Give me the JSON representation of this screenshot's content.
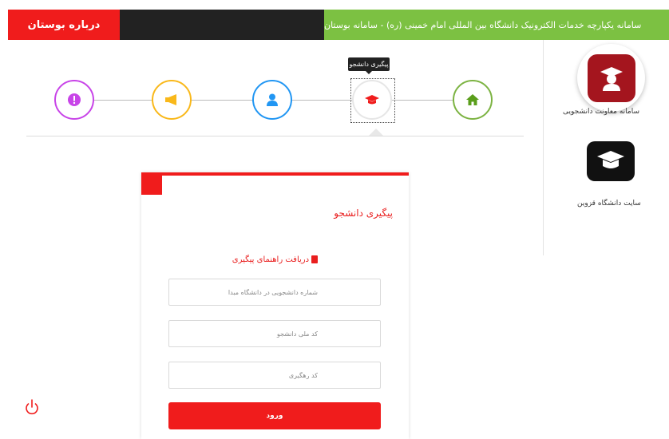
{
  "topbar": {
    "about_label": "درباره بوستان",
    "system_title": "سامانه یکپارچه خدمات الکترونیک دانشگاه بین المللی امام خمینی (ره) - سامانه بوستان"
  },
  "steps": {
    "active_tooltip": "پیگیری دانشجو",
    "items": [
      "home-icon",
      "graduation-cap-icon",
      "user-icon",
      "megaphone-icon",
      "alert-icon"
    ]
  },
  "side_links": [
    {
      "label": "سامانه معاونت دانشجویی",
      "icon": "student-affairs-icon"
    },
    {
      "label": "سایت دانشگاه قزوین",
      "icon": "university-cap-icon"
    }
  ],
  "form": {
    "title": "پیگیری دانشجو",
    "guide_link": "دریافت راهنمای پیگیری",
    "fields": [
      {
        "placeholder": "شماره دانشجویی در دانشگاه مبدا"
      },
      {
        "placeholder": "کد ملی دانشجو"
      },
      {
        "placeholder": "کد رهگیری"
      }
    ],
    "submit_label": "ورود"
  },
  "colors": {
    "brand_red": "#f01c1c",
    "green": "#7cc142",
    "dark": "#222222"
  }
}
